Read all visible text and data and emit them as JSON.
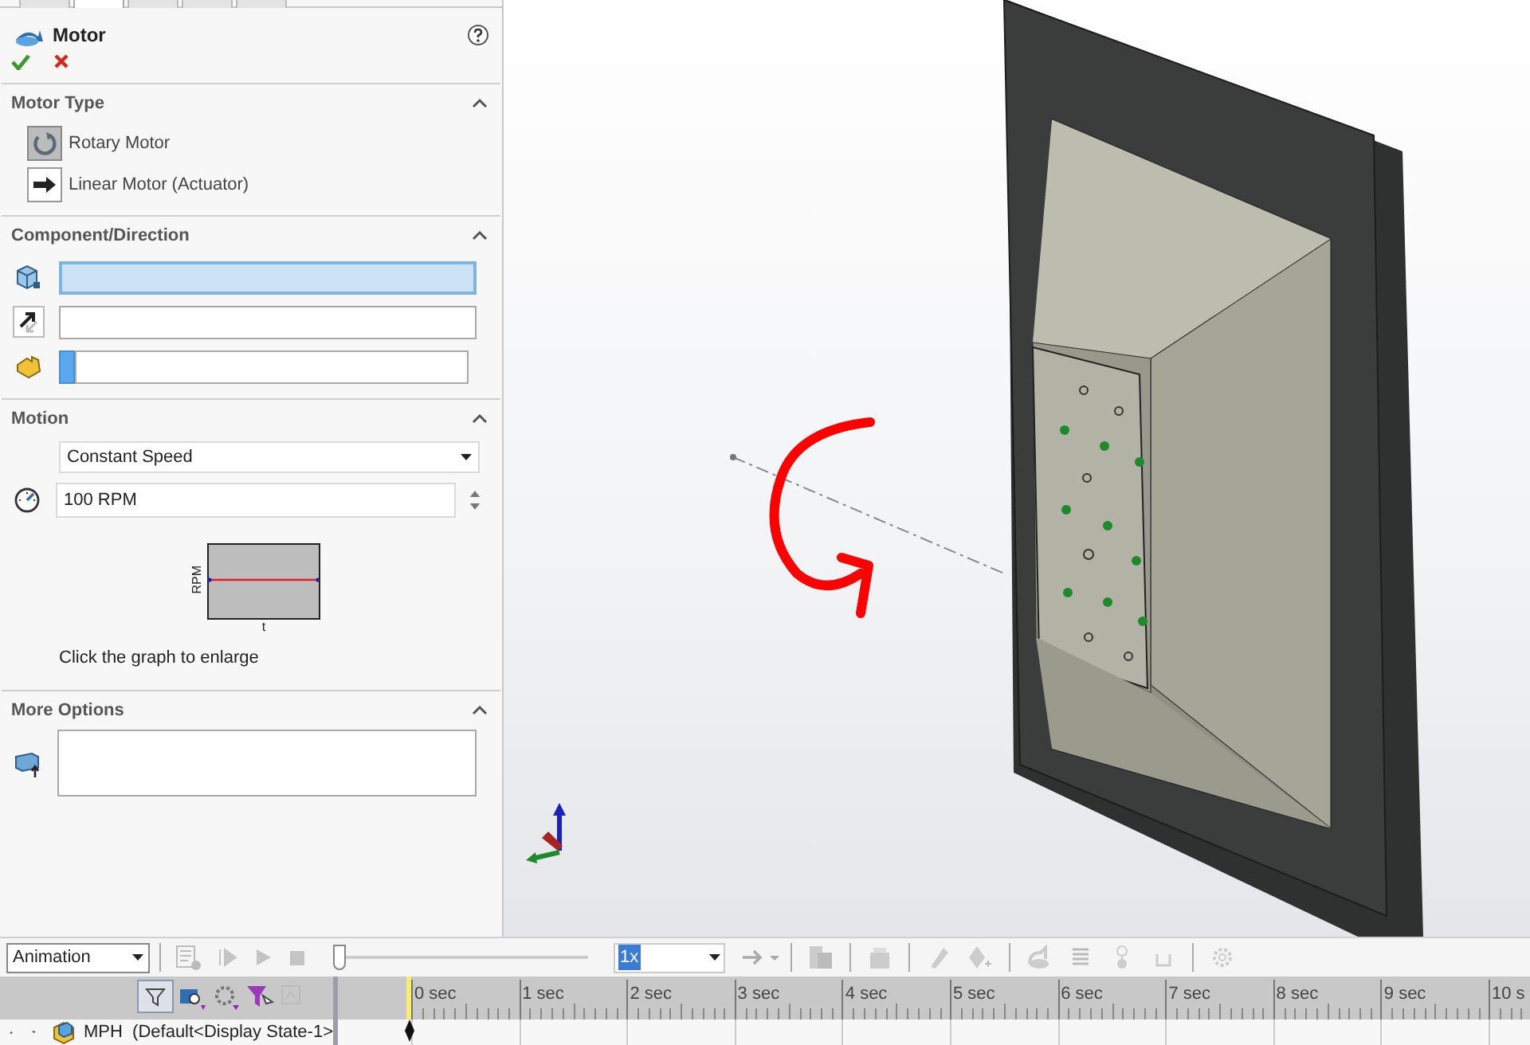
{
  "panel_tabs": [
    {
      "selected": false
    },
    {
      "selected": true
    },
    {
      "selected": false
    },
    {
      "selected": false
    },
    {
      "selected": false
    }
  ],
  "property_manager": {
    "title": "Motor",
    "sections": [
      {
        "kind": "motor_type",
        "title": "Motor Type",
        "expanded": true,
        "options": [
          {
            "label": "Rotary Motor",
            "selected": true
          },
          {
            "label": "Linear Motor (Actuator)",
            "selected": false
          }
        ]
      },
      {
        "kind": "component_direction",
        "title": "Component/Direction",
        "expanded": true,
        "fields": [
          {
            "kind": "selection",
            "active": true
          },
          {
            "kind": "selection",
            "active": false
          },
          {
            "kind": "list",
            "active": false
          }
        ]
      },
      {
        "kind": "motion",
        "title": "Motion",
        "expanded": true,
        "motion_type": "Constant Speed",
        "speed": "100 RPM",
        "graph_ylabel": "RPM",
        "graph_xlabel": "t",
        "caption": "Click the graph to enlarge"
      },
      {
        "kind": "more_options",
        "title": "More Options",
        "expanded": true
      }
    ]
  },
  "timeline_toolbar": {
    "mode": "Animation",
    "playback_speed": "1x",
    "position": {
      "level": 0
    }
  },
  "timeline": {
    "ticks": [
      "0 sec",
      "1 sec",
      "2 sec",
      "3 sec",
      "4 sec",
      "5 sec",
      "6 sec",
      "7 sec",
      "8 sec",
      "9 sec",
      "10 s"
    ],
    "rows": [
      {
        "label": "MPH  (Default<Display State-1>",
        "expanded": true
      }
    ]
  }
}
